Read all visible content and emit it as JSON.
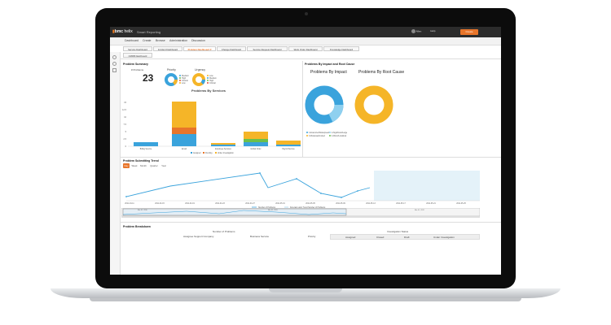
{
  "app": {
    "brand": "bmc",
    "brand_suffix": "helix",
    "title": "Smart Reporting"
  },
  "user": {
    "line1": "Allen",
    "line2": "Allbrook",
    "label": "Help"
  },
  "top_button": "Create",
  "menu": [
    "Dashboard",
    "Create",
    "Browse",
    "Administration",
    "Discussion"
  ],
  "tabs": [
    {
      "label": "Service Dashboard",
      "active": false
    },
    {
      "label": "Incident Dashboard",
      "active": false
    },
    {
      "label": "Problem Dashboard ▾",
      "active": true
    },
    {
      "label": "Change Dashboard",
      "active": false
    },
    {
      "label": "Service Request Dashboard",
      "active": false
    },
    {
      "label": "Work Order Dashboard",
      "active": false
    },
    {
      "label": "Knowledge Dashboard",
      "active": false
    }
  ],
  "tab2": "CMDB Dashboard",
  "summary": {
    "title": "Problem Summary",
    "count_label": "# Problems",
    "count": "23",
    "priority_label": "Priority",
    "urgency_label": "Urgency",
    "priority_legend": [
      "Medium",
      "High",
      "Critical",
      "Low"
    ],
    "urgency_legend": [
      "Low",
      "Medium",
      "High",
      "Critical"
    ]
  },
  "services": {
    "title": "Problems By Services",
    "categories": [
      "Billing Service",
      "Email",
      "Employee Services",
      "Global Order",
      "Payroll Service"
    ],
    "yticks": [
      "15",
      "12.5",
      "10",
      "7.5",
      "5",
      "2.5",
      "0"
    ],
    "legend": [
      "Assigned",
      "Pending",
      "Under Investigation"
    ]
  },
  "impact": {
    "section": "Problems By Impact and Root Cause",
    "impact_title": "Problems By Impact",
    "root_title": "Problems By Root Cause",
    "impact_legend": [
      "1-Extensive/Widespread",
      "2-Significant/Large",
      "3-Moderate/Limited",
      "4-Minor/Localized"
    ]
  },
  "trend": {
    "title": "Problem Submitting Trend",
    "ranges": [
      "Day",
      "Week",
      "Month",
      "Quarter",
      "Year"
    ],
    "active": "Day",
    "xlabels": [
      "2011-04-11",
      "2011-04-15",
      "2011-04-19",
      "2011-04-23",
      "2011-04-27",
      "2011-05-01",
      "2011-05-05",
      "2011-05-09",
      "2011-05-13",
      "2011-05-17",
      "2011-05-21",
      "2011-05-25"
    ],
    "legend1": "Number of Problems",
    "legend2": "Forecast using Trend Number of Problems",
    "nav_labels": [
      "Mar 01, 2010",
      "Mar 01, 2011",
      "Mar 01, 2012"
    ]
  },
  "breakdown": {
    "title": "Problem Breakdown",
    "num_label": "Number of Problems",
    "status_label": "Investigation Status",
    "columns": [
      "Assignee Support Company",
      "Business Service",
      "Priority"
    ],
    "status_cols": [
      "Assigned",
      "Closed",
      "Draft",
      "Under Investigation"
    ]
  },
  "colors": {
    "accent": "#e8752a",
    "blue": "#3aa3dc",
    "yellow": "#f5b528",
    "green": "#6cc04a",
    "red": "#e24a3b"
  }
}
